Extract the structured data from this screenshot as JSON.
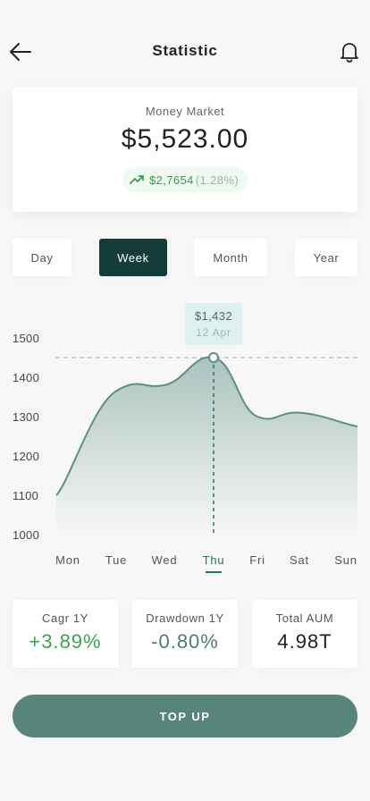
{
  "header": {
    "title": "Statistic",
    "back_icon": "arrow-left-icon",
    "bell_icon": "bell-icon"
  },
  "balance": {
    "label": "Money Market",
    "amount": "$5,523.00",
    "change_value": "$2,7654",
    "change_percent": "(1.28%)",
    "trend_icon": "trending-up-icon",
    "trend_color": "#3a9a49"
  },
  "periods": [
    {
      "label": "Day",
      "active": false
    },
    {
      "label": "Week",
      "active": true
    },
    {
      "label": "Month",
      "active": false
    },
    {
      "label": "Year",
      "active": false
    }
  ],
  "tooltip": {
    "value": "$1,432",
    "date": "12 Apr"
  },
  "chart_data": {
    "type": "area",
    "title": "",
    "xlabel": "",
    "ylabel": "",
    "categories": [
      "Mon",
      "Tue",
      "Wed",
      "Thu",
      "Fri",
      "Sat",
      "Sun"
    ],
    "y_ticks": [
      "1500",
      "1400",
      "1300",
      "1200",
      "1100",
      "1000"
    ],
    "ylim": [
      1000,
      1500
    ],
    "active_category": "Thu",
    "highlight": {
      "x": "Thu",
      "y": 1450
    },
    "series": [
      {
        "values": [
          1100,
          1365,
          1380,
          1450,
          1300,
          1310,
          1275
        ]
      }
    ],
    "line_color": "#5d8e84",
    "fill_color": "#5d8e84",
    "grid": false
  },
  "stats": [
    {
      "label": "Cagr 1Y",
      "value": "+3.89%",
      "color": "#3fa152"
    },
    {
      "label": "Drawdown 1Y",
      "value": "-0.80%",
      "color": "#4f7c74"
    },
    {
      "label": "Total AUM",
      "value": "4.98T",
      "color": "#222222"
    }
  ],
  "topup": {
    "label": "TOP UP"
  }
}
